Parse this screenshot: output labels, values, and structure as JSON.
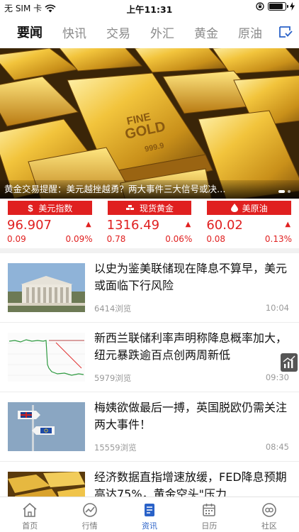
{
  "status_bar": {
    "carrier": "无 SIM 卡",
    "time": "上午11:31",
    "battery_level": 0.85
  },
  "top_tabs": [
    {
      "label": "要闻",
      "active": true
    },
    {
      "label": "快讯",
      "active": false
    },
    {
      "label": "交易",
      "active": false
    },
    {
      "label": "外汇",
      "active": false
    },
    {
      "label": "黄金",
      "active": false
    },
    {
      "label": "原油",
      "active": false
    }
  ],
  "banner": {
    "caption": "黄金交易提醒：美元越挫越勇？两大事件三大信号或决…",
    "bar_text": [
      "FINE",
      "GOLD",
      "999.9"
    ],
    "page_count": 2,
    "active_page": 1
  },
  "quotes": [
    {
      "name": "美元指数",
      "icon": "dollar-icon",
      "price": "96.907",
      "change": "0.09",
      "percent": "0.09%"
    },
    {
      "name": "现货黄金",
      "icon": "gold-bars-icon",
      "price": "1316.49",
      "change": "0.78",
      "percent": "0.06%"
    },
    {
      "name": "美原油",
      "icon": "oil-drop-icon",
      "price": "60.02",
      "change": "0.08",
      "percent": "0.13%"
    }
  ],
  "news": [
    {
      "title": "以史为鉴美联储现在降息不算早，美元或面临下行风险",
      "views": "6414浏览",
      "time": "10:04"
    },
    {
      "title": "新西兰联储利率声明称降息概率加大，纽元暴跌逾百点创两周新低",
      "views": "5979浏览",
      "time": "09:30"
    },
    {
      "title": "梅姨欲做最后一搏，英国脱欧仍需关注两大事件！",
      "views": "15559浏览",
      "time": "08:45"
    },
    {
      "title": "经济数据直指增速放缓，FED降息预期高达75%，黄金空头\"压力",
      "views": "",
      "time": ""
    }
  ],
  "bottom_nav": [
    {
      "label": "首页",
      "icon": "home-icon",
      "active": false
    },
    {
      "label": "行情",
      "icon": "market-chart-icon",
      "active": false
    },
    {
      "label": "资讯",
      "icon": "news-icon",
      "active": true
    },
    {
      "label": "日历",
      "icon": "calendar-icon",
      "active": false
    },
    {
      "label": "社区",
      "icon": "community-icon",
      "active": false
    }
  ],
  "colors": {
    "accent_red": "#e02020",
    "nav_active": "#2a62c8"
  }
}
